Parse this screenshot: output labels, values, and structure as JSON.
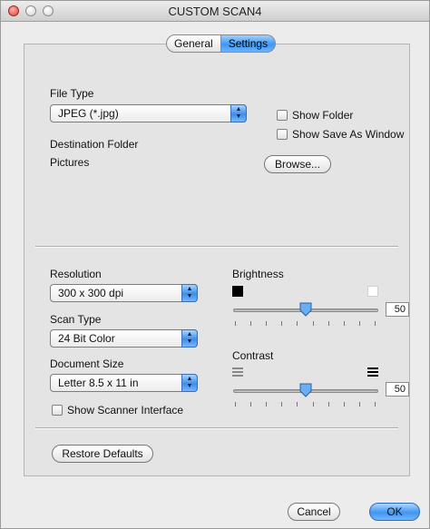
{
  "window": {
    "title": "CUSTOM SCAN4"
  },
  "tabs": {
    "general": "General",
    "settings": "Settings"
  },
  "file_type": {
    "label": "File Type",
    "value": "JPEG (*.jpg)"
  },
  "show_folder": {
    "label": "Show Folder",
    "checked": false
  },
  "show_save_as": {
    "label": "Show Save As Window",
    "checked": false
  },
  "destination": {
    "label": "Destination Folder",
    "value": "Pictures",
    "browse": "Browse..."
  },
  "resolution": {
    "label": "Resolution",
    "value": "300 x 300 dpi"
  },
  "scan_type": {
    "label": "Scan Type",
    "value": "24 Bit Color"
  },
  "document_size": {
    "label": "Document Size",
    "value": "Letter  8.5 x 11 in"
  },
  "show_scanner_interface": {
    "label": "Show Scanner Interface",
    "checked": false
  },
  "brightness": {
    "label": "Brightness",
    "value": "50"
  },
  "contrast": {
    "label": "Contrast",
    "value": "50"
  },
  "buttons": {
    "restore": "Restore Defaults",
    "cancel": "Cancel",
    "ok": "OK"
  }
}
